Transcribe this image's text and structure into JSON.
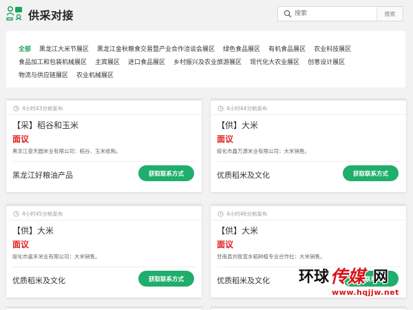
{
  "header": {
    "title": "供采对接",
    "search_placeholder": "搜索",
    "search_button": "搜索"
  },
  "filters": {
    "row1": [
      "全部",
      "黑龙江大米节展区",
      "黑龙江金秋粮食交易暨产业合作洽谈会展区",
      "绿色食品展区",
      "有机食品展区",
      "农业科技展区"
    ],
    "row2": [
      "食品加工和包装机械展区",
      "主宾展区",
      "进口食品展区",
      "乡村振兴及农业旅游展区",
      "现代化大农业展区",
      "创意设计展区"
    ],
    "row3": [
      "物流与供应链展区",
      "农业机械展区"
    ]
  },
  "cards": [
    {
      "time": "4小时43分前发布",
      "title": "【采】稻谷和玉米",
      "price": "面议",
      "desc": "黑龙江查天圆米业有限公司：稻谷、玉米收购。",
      "company": "黑龙江好粮油产品",
      "button": "获取联系方式"
    },
    {
      "time": "4小时44分前发布",
      "title": "【供】大米",
      "price": "面议",
      "desc": "绥化市鑫万源米业有限公司：大米销售。",
      "company": "优质稻米及文化",
      "button": "获取联系方式"
    },
    {
      "time": "4小时45分前发布",
      "title": "【供】大米",
      "price": "面议",
      "desc": "绥化市嘉禾米业有限公司：大米销售。",
      "company": "优质稻米及文化",
      "button": "获取联系方式"
    },
    {
      "time": "4小时46分前发布",
      "title": "【供】大米",
      "price": "面议",
      "desc": "甘南县刘俊宽水稻种植专业合作社：大米销售。",
      "company": "优质稻米及文化",
      "button": "获取联系方式"
    }
  ],
  "watermark": {
    "text": "环球传媒网",
    "url": "www.hqjjw.net"
  },
  "colors": {
    "accent": "#1fae6b",
    "price": "#e02020",
    "active_filter": "#1ea35e"
  }
}
